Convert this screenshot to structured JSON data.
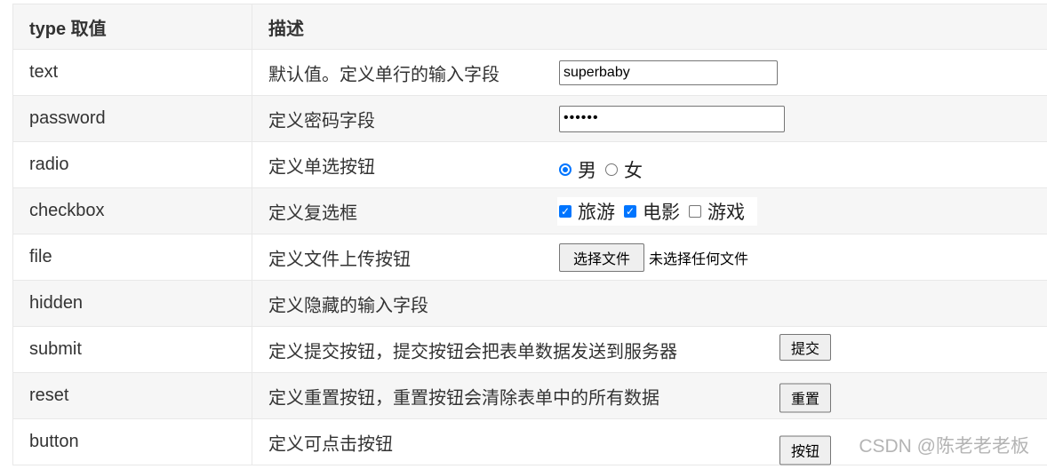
{
  "table": {
    "header": {
      "type_col": "type 取值",
      "desc_col": "描述"
    },
    "rows": {
      "text": {
        "type": "text",
        "desc": "默认值。定义单行的输入字段",
        "value": "superbaby"
      },
      "password": {
        "type": "password",
        "desc": "定义密码字段",
        "value": "••••••"
      },
      "radio": {
        "type": "radio",
        "desc": "定义单选按钮",
        "options": [
          "男",
          "女"
        ],
        "selected": "男"
      },
      "checkbox": {
        "type": "checkbox",
        "desc": "定义复选框",
        "options": [
          "旅游",
          "电影",
          "游戏"
        ],
        "checked": [
          "旅游",
          "电影"
        ]
      },
      "file": {
        "type": "file",
        "desc": "定义文件上传按钮",
        "button_label": "选择文件",
        "status": "未选择任何文件"
      },
      "hidden": {
        "type": "hidden",
        "desc": "定义隐藏的输入字段"
      },
      "submit": {
        "type": "submit",
        "desc": "定义提交按钮，提交按钮会把表单数据发送到服务器",
        "button_label": "提交"
      },
      "reset": {
        "type": "reset",
        "desc": "定义重置按钮，重置按钮会清除表单中的所有数据",
        "button_label": "重置"
      },
      "button": {
        "type": "button",
        "desc": "定义可点击按钮",
        "button_label": "按钮"
      }
    }
  },
  "watermark": "CSDN @陈老老老板",
  "colors": {
    "accent": "#0075ff",
    "header_bg": "#f6f6f6",
    "border": "#e8e8e8"
  }
}
